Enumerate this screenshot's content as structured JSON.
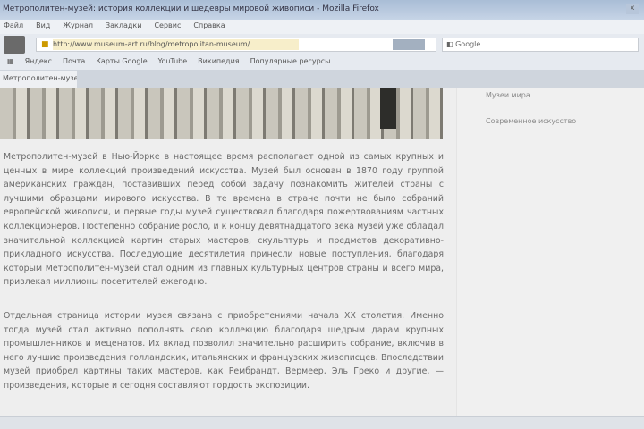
{
  "window": {
    "title": "Метрополитен-музей: история коллекции и шедевры мировой живописи - Mozilla Firefox",
    "close": "x"
  },
  "menu": [
    "Файл",
    "Вид",
    "Журнал",
    "Закладки",
    "Сервис",
    "Справка"
  ],
  "nav": {
    "url": "http://www.museum-art.ru/blog/metropolitan-museum/",
    "search_placeholder": "Google"
  },
  "bookmarks": [
    "Яндекс",
    "Почта",
    "Карты Google",
    "YouTube",
    "Википедия",
    "Популярные ресурсы"
  ],
  "tab": {
    "label": "Метрополитен-музей"
  },
  "sidebar": {
    "links": [
      "Музеи мира",
      "Современное искусство"
    ]
  },
  "article": {
    "paragraphs": [
      "Метрополитен-музей в Нью-Йорке в настоящее время располагает одной из самых крупных и ценных в мире коллекций произведений искусства. Музей был основан в 1870 году группой американских граждан, поставивших перед собой задачу познакомить жителей страны с лучшими образцами мирового искусства. В те времена в стране почти не было собраний европейской живописи, и первые годы музей существовал благодаря пожертвованиям частных коллекционеров. Постепенно собрание росло, и к концу девятнадцатого века музей уже обладал значительной коллекцией картин старых мастеров, скульптуры и предметов декоративно-прикладного искусства. Последующие десятилетия принесли новые поступления, благодаря которым Метрополитен-музей стал одним из главных культурных центров страны и всего мира, привлекая миллионы посетителей ежегодно.",
      "Отдельная страница истории музея связана с приобретениями начала XX столетия. Именно тогда музей стал активно пополнять свою коллекцию благодаря щедрым дарам крупных промышленников и меценатов. Их вклад позволил значительно расширить собрание, включив в него лучшие произведения голландских, итальянских и французских живописцев. Впоследствии музей приобрел картины таких мастеров, как Рембрандт, Вермеер, Эль Греко и другие, — произведения, которые и сегодня составляют гордость экспозиции."
    ]
  }
}
